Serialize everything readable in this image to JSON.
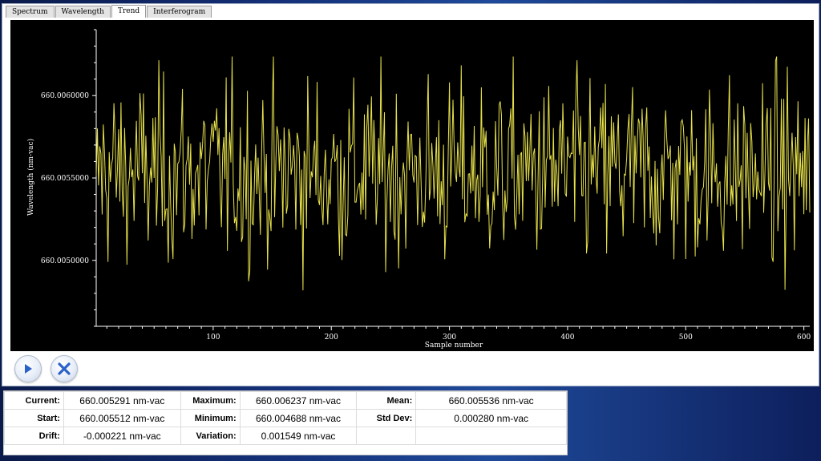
{
  "tabs": [
    {
      "label": "Spectrum",
      "active": false
    },
    {
      "label": "Wavelength",
      "active": false
    },
    {
      "label": "Trend",
      "active": true
    },
    {
      "label": "Interferogram",
      "active": false
    }
  ],
  "buttons": {
    "play": {
      "icon": "play-icon"
    },
    "close": {
      "icon": "close-x-icon"
    }
  },
  "stats": {
    "current": {
      "label": "Current:",
      "value": "660.005291 nm-vac"
    },
    "start": {
      "label": "Start:",
      "value": "660.005512 nm-vac"
    },
    "drift": {
      "label": "Drift:",
      "value": "-0.000221 nm-vac"
    },
    "maximum": {
      "label": "Maximum:",
      "value": "660.006237 nm-vac"
    },
    "minimum": {
      "label": "Minimum:",
      "value": "660.004688 nm-vac"
    },
    "variation": {
      "label": "Variation:",
      "value": "0.001549 nm-vac"
    },
    "mean": {
      "label": "Mean:",
      "value": "660.005536 nm-vac"
    },
    "std_dev": {
      "label": "Std Dev:",
      "value": "0.000280 nm-vac"
    }
  },
  "chart_data": {
    "type": "line",
    "xlabel": "Sample number",
    "ylabel": "Wavelength (nm-vac)",
    "xlim": [
      1,
      605
    ],
    "ylim": [
      660.0046,
      660.0064
    ],
    "x_ticks": [
      100,
      200,
      300,
      400,
      500,
      600
    ],
    "y_ticks": [
      660.005,
      660.0055,
      660.006
    ],
    "y_tick_labels": [
      "660.0050000",
      "660.0055000",
      "660.0060000"
    ],
    "grid": false,
    "series": [
      {
        "color": "#e6e14a",
        "n_points": 605,
        "start": 660.005512,
        "end": 660.005291,
        "min": 660.004688,
        "max": 660.006237,
        "mean": 660.005536,
        "std": 0.00028
      }
    ]
  },
  "colors": {
    "plot_bg": "#000000",
    "trace": "#e6e14a",
    "axis": "#ffffff",
    "button_icon": "#2a62c9"
  }
}
